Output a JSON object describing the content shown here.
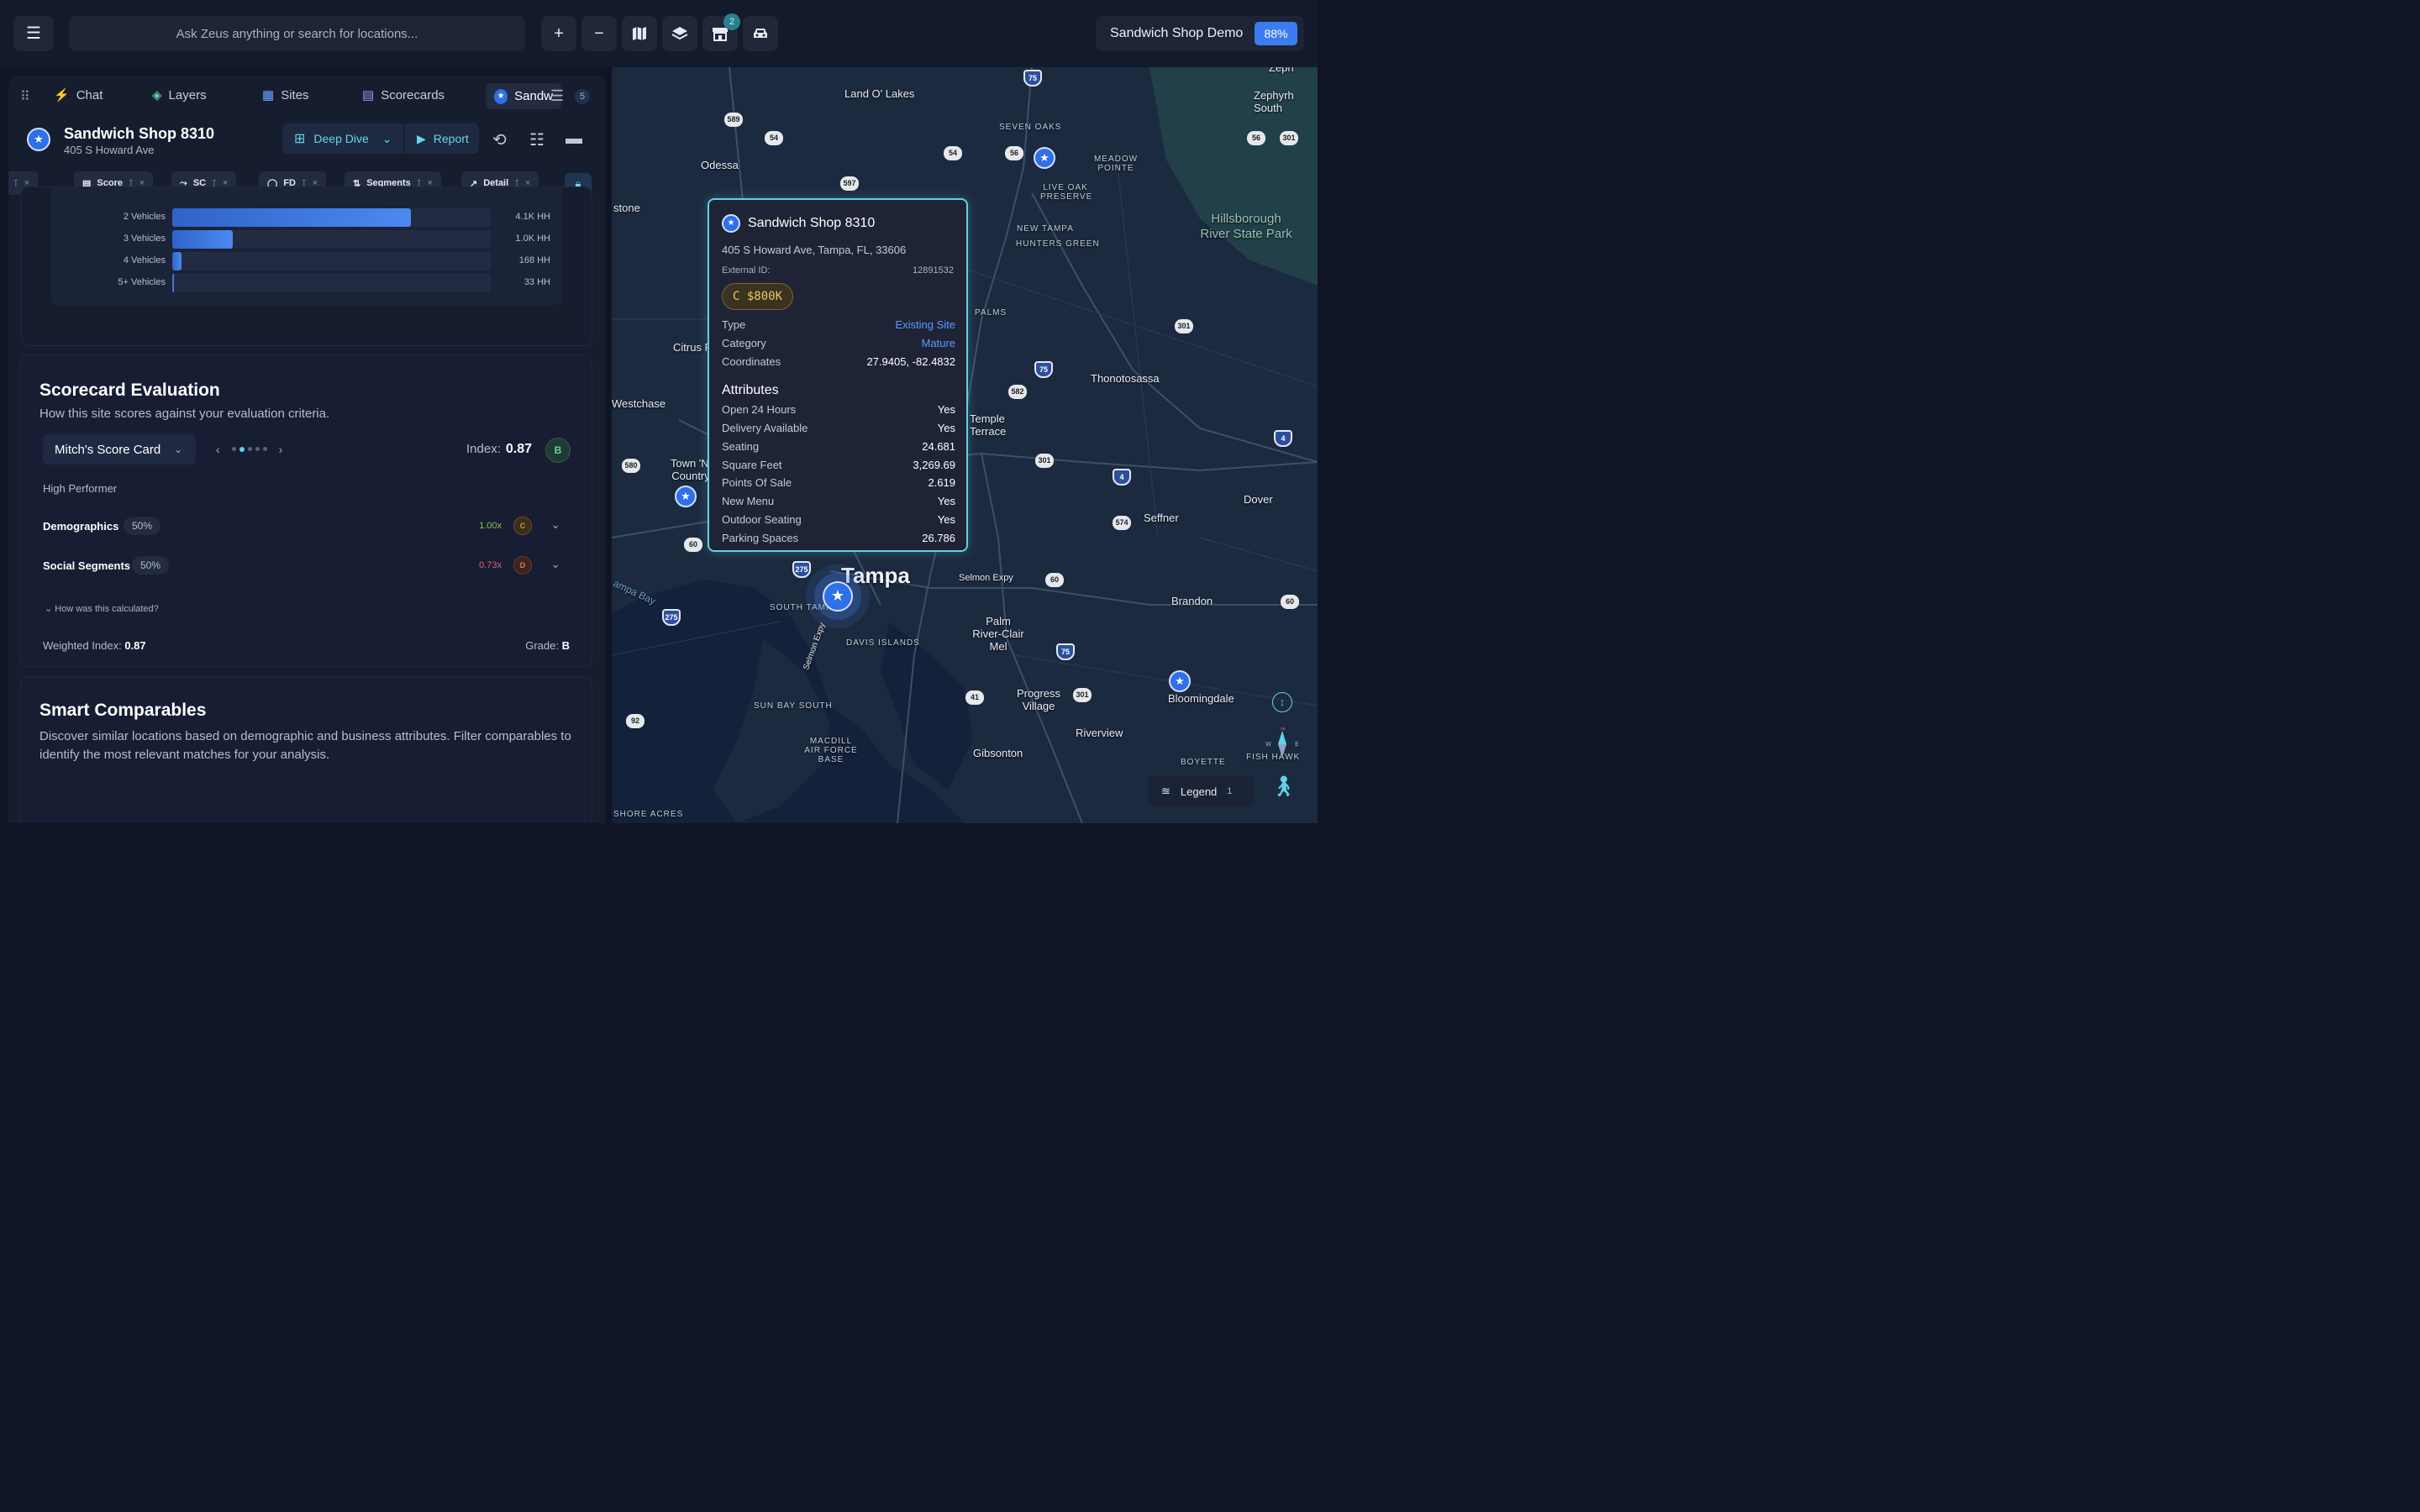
{
  "topbar": {
    "search_placeholder": "Ask Zeus anything or search for locations...",
    "store_badge": "2",
    "project_title": "Sandwich Shop Demo",
    "progress": "88%"
  },
  "tabs": [
    {
      "label": "Chat"
    },
    {
      "label": "Layers"
    },
    {
      "label": "Sites"
    },
    {
      "label": "Scorecards"
    },
    {
      "label": "Sandw"
    }
  ],
  "tab_count": "5",
  "site": {
    "name": "Sandwich Shop 8310",
    "address": "405 S Howard Ave",
    "deep_dive": "Deep Dive",
    "report": "Report"
  },
  "chips": [
    "Score",
    "SC",
    "FD",
    "Segments",
    "Detail"
  ],
  "vehicles": [
    {
      "label": "2 Vehicles",
      "value": "4.1K HH",
      "fraction": 0.75
    },
    {
      "label": "3 Vehicles",
      "value": "1.0K HH",
      "fraction": 0.19
    },
    {
      "label": "4 Vehicles",
      "value": "168 HH",
      "fraction": 0.03
    },
    {
      "label": "5+ Vehicles",
      "value": "33 HH",
      "fraction": 0.006
    }
  ],
  "scorecard": {
    "title": "Scorecard Evaluation",
    "subtitle": "How this site scores against your evaluation criteria.",
    "selected": "Mitch's Score Card",
    "index_label": "Index:",
    "index_value": "0.87",
    "grade": "B",
    "performance": "High Performer",
    "criteria": [
      {
        "name": "Demographics",
        "weight": "50%",
        "multiplier": "1.00x",
        "grade": "C",
        "color": "#8fc24a",
        "grade_color": "#d89a3a"
      },
      {
        "name": "Social Segments",
        "weight": "50%",
        "multiplier": "0.73x",
        "grade": "D",
        "color": "#e2607a",
        "grade_color": "#e07b4a"
      }
    ],
    "how": "How was this calculated?",
    "weighted_label": "Weighted Index:",
    "weighted_value": "0.87",
    "grade_label": "Grade:",
    "grade_value": "B"
  },
  "comparables": {
    "title": "Smart Comparables",
    "subtitle": "Discover similar locations based on demographic and business attributes. Filter comparables to identify the most relevant matches for your analysis."
  },
  "popup": {
    "title": "Sandwich Shop 8310",
    "address": "405 S Howard Ave, Tampa, FL, 33606",
    "external_label": "External ID:",
    "external_id": "12891532",
    "badge": "C $800K",
    "rows": [
      {
        "label": "Type",
        "value": "Existing Site"
      },
      {
        "label": "Category",
        "value": "Mature"
      },
      {
        "label": "Coordinates",
        "value": "27.9405, -82.4832"
      }
    ],
    "attributes_title": "Attributes",
    "attributes": [
      {
        "label": "Open 24 Hours",
        "value": "Yes"
      },
      {
        "label": "Delivery Available",
        "value": "Yes"
      },
      {
        "label": "Seating",
        "value": "24.681"
      },
      {
        "label": "Square Feet",
        "value": "3,269.69"
      },
      {
        "label": "Points Of Sale",
        "value": "2.619"
      },
      {
        "label": "New Menu",
        "value": "Yes"
      },
      {
        "label": "Outdoor Seating",
        "value": "Yes"
      },
      {
        "label": "Parking Spaces",
        "value": "26.786"
      }
    ]
  },
  "map": {
    "labels": {
      "land_o_lakes": "Land O' Lakes",
      "odessa": "Odessa",
      "seven_oaks": "SEVEN OAKS",
      "meadow_pointe": "MEADOW POINTE",
      "live_oak": "LIVE OAK PRESERVE",
      "new_tampa": "NEW TAMPA",
      "hunters_green": "HUNTERS GREEN",
      "hillsborough": "Hillsborough River State Park",
      "stone": "stone",
      "citrus": "Citrus P",
      "westchase": "Westchase",
      "palms": "PALMS",
      "thonotosassa": "Thonotosassa",
      "temple_terrace": "Temple Terrace",
      "town_n_country": "Town 'N' Country",
      "dover": "Dover",
      "seffner": "Seffner",
      "tampa": "Tampa",
      "south_tampa": "SOUTH TAMPA",
      "selmon_expy": "Selmon Expy",
      "selmon_expy2": "Selmon Expy",
      "brandon": "Brandon",
      "davis_islands": "DAVIS ISLANDS",
      "palm_river": "Palm River-Clair Mel",
      "tampa_bay": "ampa Bay",
      "sun_bay": "SUN BAY SOUTH",
      "progress_village": "Progress Village",
      "bloomingdale": "Bloomingdale",
      "macdill": "MACDILL AIR FORCE BASE",
      "riverview": "Riverview",
      "gibsonton": "Gibsonton",
      "boyette": "BOYETTE",
      "fish_hawk": "FISH HAWK",
      "shore_acres": "SHORE ACRES",
      "zephyrhills": "Zephyrh South",
      "zeph": "Zeph"
    }
  },
  "legend": {
    "label": "Legend",
    "count": "1"
  }
}
